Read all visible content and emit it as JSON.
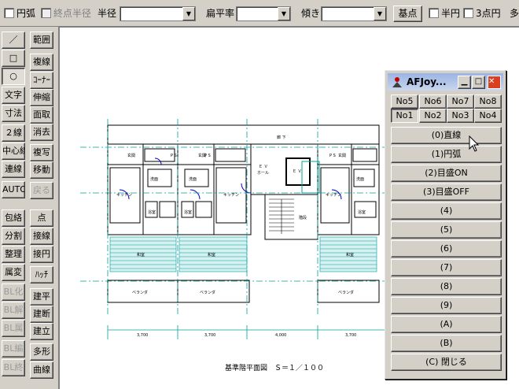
{
  "toolbar": {
    "arc_checkbox": "円弧",
    "radius_mode_checkbox": "終点半径",
    "radius_label": "半径",
    "flat_ratio_label": "扁平率",
    "tilt_label": "傾き",
    "base_point_button": "基点",
    "semicircle_checkbox": "半円",
    "three_point_checkbox": "3点円",
    "polygon_cut": "多"
  },
  "left_tools": [
    "／",
    "□",
    "○",
    "文字",
    "寸法",
    "２線",
    "中心線",
    "連線",
    "AUTO",
    "包絡",
    "分割",
    "整理",
    "属変",
    "BL化",
    "BL解",
    "BL属",
    "BL編",
    "BL終"
  ],
  "right_tools": [
    "範囲",
    "複線",
    "ｺｰﾅｰ",
    "伸縮",
    "面取",
    "消去",
    "複写",
    "移動",
    "戻る",
    "点",
    "接線",
    "接円",
    "ﾊｯﾁ",
    "建平",
    "建断",
    "建立",
    "多形",
    "曲線"
  ],
  "drawing": {
    "corridor": "廊 下",
    "ev_hall_1": "Ｅ Ｖ",
    "ev_hall_2": "ホール",
    "ev": "Ｅ Ｖ",
    "stairs": "階段",
    "entrance": "玄関",
    "ps": "P S",
    "washroom": "洗面",
    "bathroom": "浴室",
    "bath": "浴室",
    "kitchen": "キッチン",
    "closet": "物入",
    "japanese_room": "和室",
    "veranda": "ベランダ",
    "dims": [
      "3,700",
      "3,700",
      "4,000",
      "3,700",
      "3,700"
    ],
    "caption": "基準階平面図　Ｓ＝１／１００"
  },
  "afjoy": {
    "title": "AFJoy...",
    "no_buttons": [
      "No5",
      "No6",
      "No7",
      "No8",
      "No1",
      "No2",
      "No3",
      "No4"
    ],
    "commands": [
      "(0)直線",
      "(1)円弧",
      "(2)目盛ON",
      "(3)目盛OFF",
      "(4)",
      "(5)",
      "(6)",
      "(7)",
      "(8)",
      "(9)",
      "(A)",
      "(B)",
      "(C) 閉じる"
    ]
  },
  "colors": {
    "window_bg": "#d4d0c8",
    "cad_line": "#000000",
    "cad_teal": "#00a0a0",
    "cad_blue": "#0000c8",
    "cad_red": "#c00000"
  }
}
